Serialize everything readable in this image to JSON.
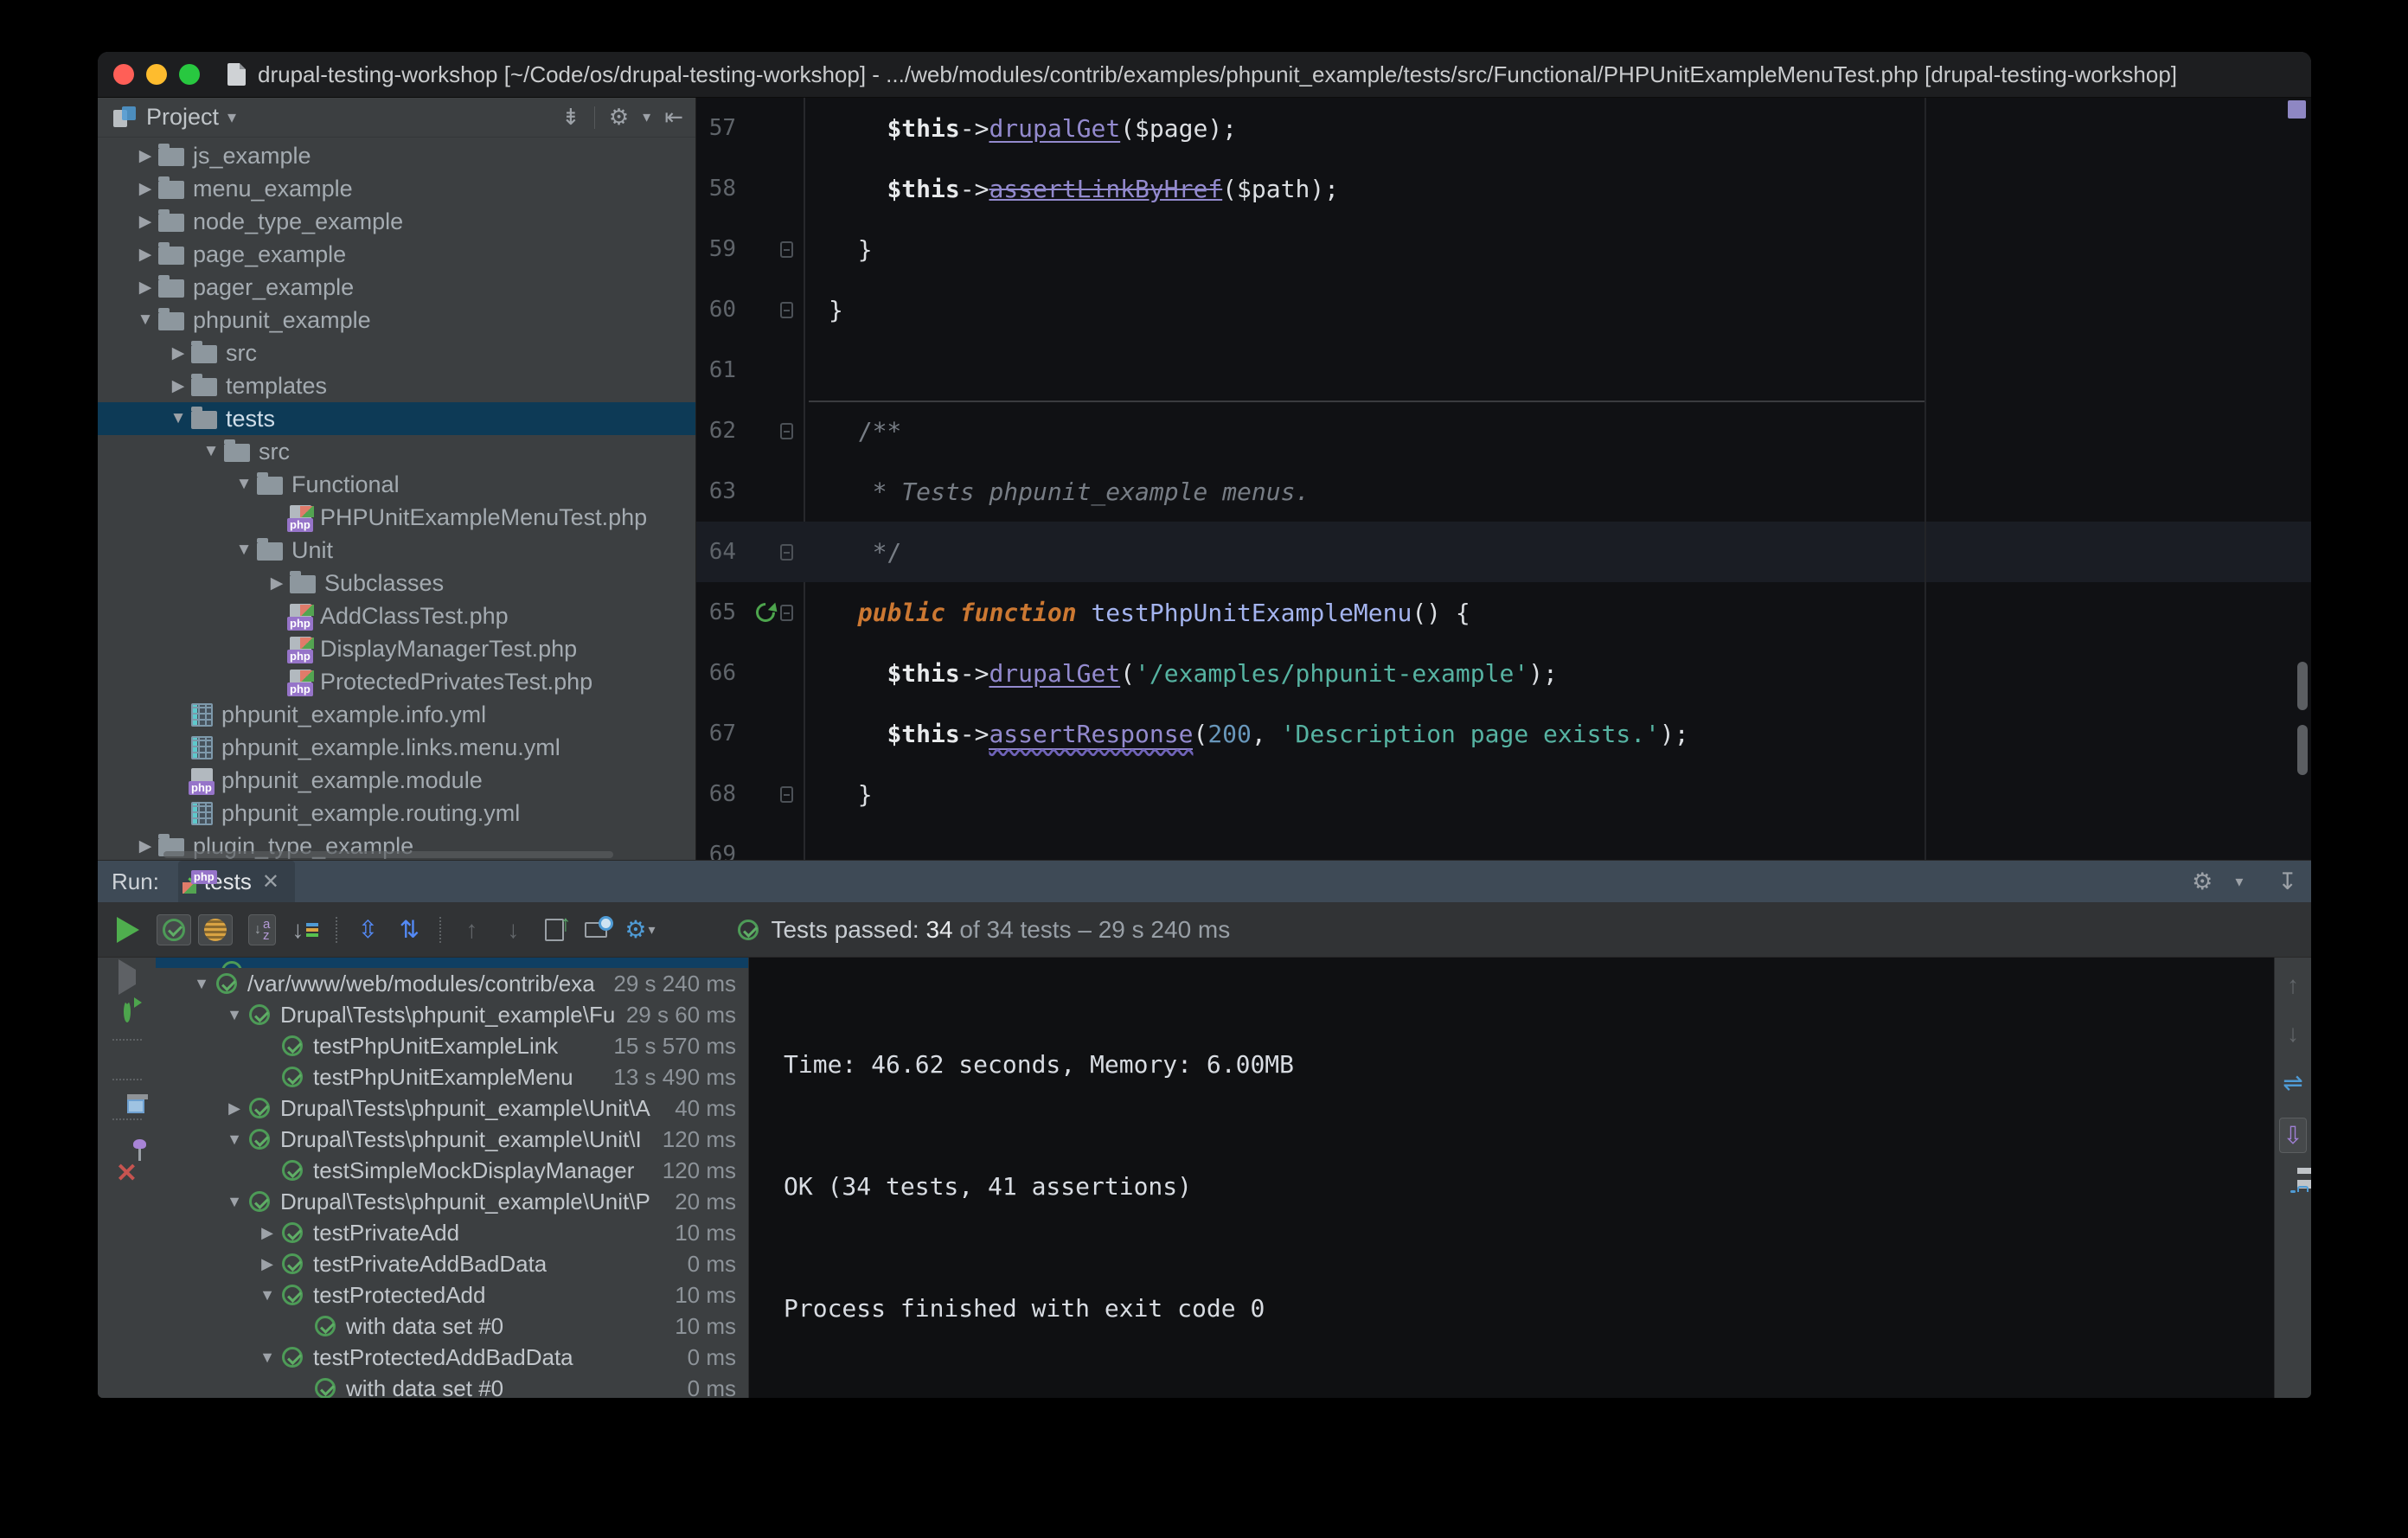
{
  "window_title": "drupal-testing-workshop [~/Code/os/drupal-testing-workshop] - .../web/modules/contrib/examples/phpunit_example/tests/src/Functional/PHPUnitExampleMenuTest.php [drupal-testing-workshop]",
  "glyphs": {
    "arrow_down": "▼",
    "arrow_right": "▶",
    "dropdown": "▾",
    "close": "✕",
    "gear": "⚙",
    "collapse_all": "⇟",
    "hide_left": "⇤",
    "hide_down": "↧",
    "expand_all": "⇳",
    "collapse_tree": "⇅",
    "up": "↑",
    "down": "↓",
    "soft_wrap": "⇌",
    "scroll_end": "⇩"
  },
  "project_panel": {
    "title": "Project",
    "tree": [
      {
        "label": "js_example",
        "level": 0,
        "arrow": "right",
        "icon": "folder"
      },
      {
        "label": "menu_example",
        "level": 0,
        "arrow": "right",
        "icon": "folder"
      },
      {
        "label": "node_type_example",
        "level": 0,
        "arrow": "right",
        "icon": "folder"
      },
      {
        "label": "page_example",
        "level": 0,
        "arrow": "right",
        "icon": "folder"
      },
      {
        "label": "pager_example",
        "level": 0,
        "arrow": "right",
        "icon": "folder"
      },
      {
        "label": "phpunit_example",
        "level": 0,
        "arrow": "down",
        "icon": "folder"
      },
      {
        "label": "src",
        "level": 1,
        "arrow": "right",
        "icon": "folder"
      },
      {
        "label": "templates",
        "level": 1,
        "arrow": "right",
        "icon": "folder"
      },
      {
        "label": "tests",
        "level": 1,
        "arrow": "down",
        "icon": "folder",
        "selected": true
      },
      {
        "label": "src",
        "level": 2,
        "arrow": "down",
        "icon": "folder"
      },
      {
        "label": "Functional",
        "level": 3,
        "arrow": "down",
        "icon": "folder"
      },
      {
        "label": "PHPUnitExampleMenuTest.php",
        "level": 4,
        "arrow": "none",
        "icon": "php-test"
      },
      {
        "label": "Unit",
        "level": 3,
        "arrow": "down",
        "icon": "folder"
      },
      {
        "label": "Subclasses",
        "level": 4,
        "arrow": "right",
        "icon": "folder"
      },
      {
        "label": "AddClassTest.php",
        "level": 4,
        "arrow": "none",
        "icon": "php-test"
      },
      {
        "label": "DisplayManagerTest.php",
        "level": 4,
        "arrow": "none",
        "icon": "php-test"
      },
      {
        "label": "ProtectedPrivatesTest.php",
        "level": 4,
        "arrow": "none",
        "icon": "php-test"
      },
      {
        "label": "phpunit_example.info.yml",
        "level": 1,
        "arrow": "none",
        "icon": "yml"
      },
      {
        "label": "phpunit_example.links.menu.yml",
        "level": 1,
        "arrow": "none",
        "icon": "yml"
      },
      {
        "label": "phpunit_example.module",
        "level": 1,
        "arrow": "none",
        "icon": "module"
      },
      {
        "label": "phpunit_example.routing.yml",
        "level": 1,
        "arrow": "none",
        "icon": "yml"
      },
      {
        "label": "plugin_type_example",
        "level": 0,
        "arrow": "right",
        "icon": "folder"
      }
    ]
  },
  "editor": {
    "lines": [
      {
        "num": "57",
        "gutter": [],
        "tokens": [
          [
            "    ",
            "pl"
          ],
          [
            "$this",
            "bd"
          ],
          [
            "->",
            "pl"
          ],
          [
            "drupalGet",
            "mu"
          ],
          [
            "(",
            "pl"
          ],
          [
            "$page",
            "pl"
          ],
          [
            ");",
            "pl"
          ]
        ]
      },
      {
        "num": "58",
        "gutter": [],
        "tokens": [
          [
            "    ",
            "pl"
          ],
          [
            "$this",
            "bd"
          ],
          [
            "->",
            "pl"
          ],
          [
            "assertLinkByHref",
            "mdep"
          ],
          [
            "(",
            "pl"
          ],
          [
            "$path",
            "pl"
          ],
          [
            ");",
            "pl"
          ]
        ]
      },
      {
        "num": "59",
        "gutter": [
          "lock"
        ],
        "tokens": [
          [
            "  }",
            "pl"
          ]
        ]
      },
      {
        "num": "60",
        "gutter": [
          "lock"
        ],
        "tokens": [
          [
            "}",
            "pl"
          ]
        ]
      },
      {
        "num": "61",
        "gutter": [],
        "tokens": []
      },
      {
        "num": "62",
        "gutter": [
          "lock"
        ],
        "separator": true,
        "tokens": [
          [
            "  /**",
            "cm"
          ]
        ]
      },
      {
        "num": "63",
        "gutter": [],
        "tokens": [
          [
            "   * Tests phpunit_example menus.",
            "cmi"
          ]
        ]
      },
      {
        "num": "64",
        "gutter": [
          "lock"
        ],
        "caret": true,
        "tokens": [
          [
            "   */",
            "cm"
          ]
        ]
      },
      {
        "num": "65",
        "gutter": [
          "run",
          "lock"
        ],
        "tokens": [
          [
            "  ",
            "pl"
          ],
          [
            "public",
            "kw"
          ],
          [
            " ",
            "pl"
          ],
          [
            "function",
            "kw"
          ],
          [
            " ",
            "pl"
          ],
          [
            "testPhpUnitExampleMenu",
            "fn"
          ],
          [
            "() {",
            "pl"
          ]
        ]
      },
      {
        "num": "66",
        "gutter": [],
        "tokens": [
          [
            "    ",
            "pl"
          ],
          [
            "$this",
            "bd"
          ],
          [
            "->",
            "pl"
          ],
          [
            "drupalGet",
            "mu"
          ],
          [
            "(",
            "pl"
          ],
          [
            "'/examples/phpunit-example'",
            "s"
          ],
          [
            ");",
            "pl"
          ]
        ]
      },
      {
        "num": "67",
        "gutter": [],
        "tokens": [
          [
            "    ",
            "pl"
          ],
          [
            "$this",
            "bd"
          ],
          [
            "->",
            "pl"
          ],
          [
            "assertResponse",
            "mwav"
          ],
          [
            "(",
            "pl"
          ],
          [
            "200",
            "n"
          ],
          [
            ", ",
            "pl"
          ],
          [
            "'Description page exists.'",
            "s"
          ],
          [
            ");",
            "pl"
          ]
        ]
      },
      {
        "num": "68",
        "gutter": [
          "lock"
        ],
        "tokens": [
          [
            "  }",
            "pl"
          ]
        ]
      },
      {
        "num": "69",
        "gutter": [],
        "tokens": []
      }
    ]
  },
  "run_panel": {
    "run_label": "Run:",
    "tab": {
      "title": "tests"
    },
    "status": {
      "prefix": "Tests passed: ",
      "count": "34",
      "suffix": " of 34 tests – 29 s 240 ms"
    },
    "tests_tree": [
      {
        "level": 0,
        "arrow": "down",
        "label": "/var/www/web/modules/contrib/exa",
        "time": "29 s 240 ms"
      },
      {
        "level": 1,
        "arrow": "down",
        "label": "Drupal\\Tests\\phpunit_example\\Fu",
        "time": "29 s 60 ms"
      },
      {
        "level": 2,
        "arrow": "none",
        "label": "testPhpUnitExampleLink",
        "time": "15 s 570 ms"
      },
      {
        "level": 2,
        "arrow": "none",
        "label": "testPhpUnitExampleMenu",
        "time": "13 s 490 ms"
      },
      {
        "level": 1,
        "arrow": "right",
        "label": "Drupal\\Tests\\phpunit_example\\Unit\\A",
        "time": "40 ms"
      },
      {
        "level": 1,
        "arrow": "down",
        "label": "Drupal\\Tests\\phpunit_example\\Unit\\I",
        "time": "120 ms"
      },
      {
        "level": 2,
        "arrow": "none",
        "label": "testSimpleMockDisplayManager",
        "time": "120 ms"
      },
      {
        "level": 1,
        "arrow": "down",
        "label": "Drupal\\Tests\\phpunit_example\\Unit\\P",
        "time": "20 ms"
      },
      {
        "level": 2,
        "arrow": "right",
        "label": "testPrivateAdd",
        "time": "10 ms"
      },
      {
        "level": 2,
        "arrow": "right",
        "label": "testPrivateAddBadData",
        "time": "0 ms"
      },
      {
        "level": 2,
        "arrow": "down",
        "label": "testProtectedAdd",
        "time": "10 ms"
      },
      {
        "level": 3,
        "arrow": "none",
        "label": "with data set #0",
        "time": "10 ms"
      },
      {
        "level": 2,
        "arrow": "down",
        "label": "testProtectedAddBadData",
        "time": "0 ms"
      },
      {
        "level": 3,
        "arrow": "none",
        "label": "with data set #0",
        "time": "0 ms"
      }
    ],
    "console_lines": [
      "Time: 46.62 seconds, Memory: 6.00MB",
      "OK (34 tests, 41 assertions)",
      "Process finished with exit code 0"
    ]
  }
}
